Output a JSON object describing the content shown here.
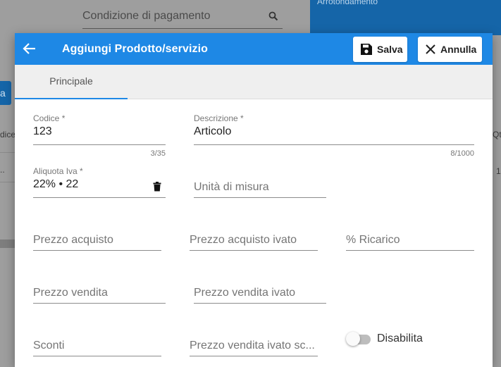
{
  "background": {
    "search_label": "Condizione di pagamento",
    "panel_label": "Arrotondamento",
    "left_button_label": "a",
    "left_column_text": "dice",
    "left_row_text": "..",
    "right_column_text": "Qt",
    "right_row_text": "1"
  },
  "dialog": {
    "title": "Aggiungi Prodotto/servizio",
    "save_label": "Salva",
    "cancel_label": "Annulla",
    "tabs": [
      {
        "label": "Principale",
        "active": true
      }
    ]
  },
  "form": {
    "codice": {
      "label": "Codice *",
      "value": "123",
      "counter": "3/35"
    },
    "descrizione": {
      "label": "Descrizione *",
      "value": "Articolo",
      "counter": "8/1000"
    },
    "aliquota_iva": {
      "label": "Aliquota Iva *",
      "value": "22% • 22"
    },
    "unita_misura": {
      "placeholder": "Unità di misura"
    },
    "prezzo_acquisto": {
      "placeholder": "Prezzo acquisto"
    },
    "prezzo_acquisto_ivato": {
      "placeholder": "Prezzo acquisto ivato"
    },
    "ricarico": {
      "placeholder": "% Ricarico"
    },
    "prezzo_vendita": {
      "placeholder": "Prezzo vendita"
    },
    "prezzo_vendita_ivato": {
      "placeholder": "Prezzo vendita ivato"
    },
    "sconti": {
      "placeholder": "Sconti"
    },
    "prezzo_vendita_ivato_scontato": {
      "placeholder": "Prezzo vendita ivato sc..."
    },
    "disabilita": {
      "label": "Disabilita",
      "checked": false
    }
  },
  "icons": {
    "search": "search-icon",
    "back": "arrow-left-icon",
    "save": "floppy-disk-icon",
    "cancel": "close-icon",
    "delete": "trash-icon"
  },
  "colors": {
    "primary": "#1e88e5",
    "background_panel": "#1565a8",
    "tab_bar": "#efefef"
  }
}
